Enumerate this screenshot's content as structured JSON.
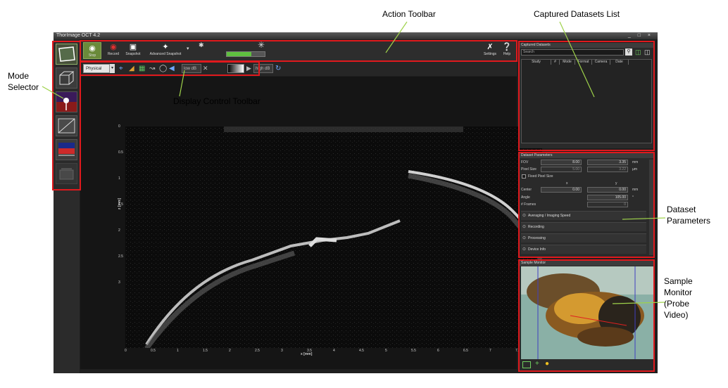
{
  "window": {
    "title": "ThorImage OCT 4.2",
    "controls": "_ □ ×"
  },
  "annotations": {
    "action_toolbar": "Action Toolbar",
    "captured_datasets": "Captured Datasets List",
    "mode_selector_line1": "Mode",
    "mode_selector_line2": "Selector",
    "display_control": "Display Control Toolbar",
    "dataset_params_line1": "Dataset",
    "dataset_params_line2": "Parameters",
    "sample_monitor_line1": "Sample",
    "sample_monitor_line2": "Monitor",
    "sample_monitor_line3": "(Probe",
    "sample_monitor_line4": "Video)"
  },
  "mode_buttons": [
    "2d-mode-icon",
    "3d-mode-icon",
    "doppler-mode-icon",
    "speckle-mode-icon",
    "spectrum-mode-icon",
    "file-mode-icon"
  ],
  "action_toolbar": {
    "stop": "Stop",
    "record": "Record",
    "snapshot": "Snapshot",
    "advanced_snapshot": "Advanced Snapshot",
    "brightness_level": 0.65,
    "settings": "Settings",
    "help": "Help"
  },
  "display_toolbar": {
    "unit_select": "Physical",
    "low_db": "low dB",
    "high_db": "high dB"
  },
  "plot": {
    "y_label": "z [mm]",
    "x_label": "x [mm]",
    "y_ticks": [
      "0",
      "0.5",
      "1",
      "1.5",
      "2",
      "2.5",
      "3"
    ],
    "x_ticks": [
      "0",
      "0.5",
      "1",
      "1.5",
      "2",
      "2.5",
      "3",
      "3.5",
      "4",
      "4.5",
      "5",
      "5.5",
      "6",
      "6.5",
      "7",
      "7.5",
      "8"
    ]
  },
  "captured_datasets": {
    "title": "Captured Datasets",
    "search_placeholder": "Search",
    "columns": [
      "Study",
      "#",
      "Mode",
      "Format",
      "Camera",
      "Date"
    ]
  },
  "dataset_parameters": {
    "title": "Dataset Parameters",
    "fov_label": "FOV",
    "fov_x": "8.00",
    "fov_y": "3.35",
    "fov_unit": "mm",
    "pixel_size_label": "Pixel Size",
    "pixel_x": "5.00",
    "pixel_y": "3.22",
    "pixel_unit": "µm",
    "fixed_pixel_size": "Fixed Pixel Size",
    "col_x": "x",
    "col_y": "y",
    "center_label": "Center",
    "center_x": "0.00",
    "center_y": "0.00",
    "center_unit": "mm",
    "angle_label": "Angle",
    "angle_value": "105.00",
    "angle_unit": "°",
    "frames_label": "# Frames",
    "frames_value": "0",
    "sections": [
      "Averaging / Imaging Speed",
      "Recording",
      "Processing",
      "Device Info"
    ]
  },
  "sample_monitor": {
    "title": "Sample Monitor"
  }
}
